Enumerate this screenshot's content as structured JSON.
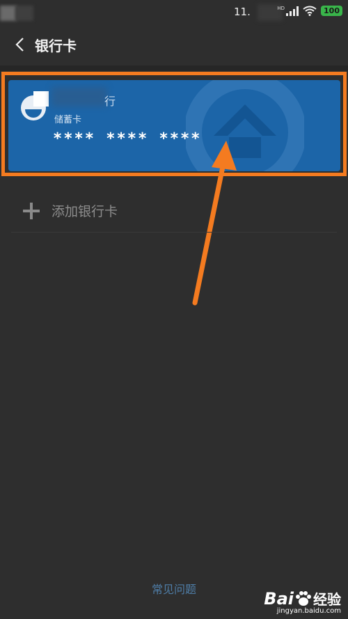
{
  "status_bar": {
    "time": "11.",
    "network_label": "HD",
    "battery": "100"
  },
  "header": {
    "title": "银行卡"
  },
  "card": {
    "bank_name": "行",
    "card_type": "储蓄卡",
    "number_masked": "**** **** ****",
    "color": "#1c65a8"
  },
  "annotation": {
    "highlight_color": "#f47b20"
  },
  "add_card": {
    "label": "添加银行卡"
  },
  "footer": {
    "faq_label": "常见问题"
  },
  "watermark": {
    "brand": "Bai",
    "brand_cn": "经验",
    "url": "jingyan.baidu.com"
  }
}
